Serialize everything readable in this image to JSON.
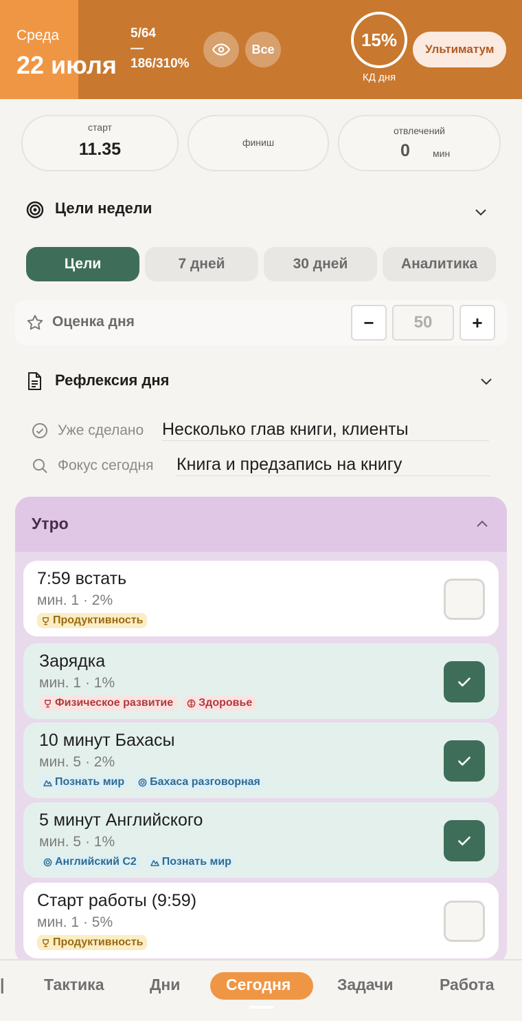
{
  "header": {
    "weekday": "Среда",
    "date": "22 июля",
    "stat_top": "5/64",
    "stat_dash": "—",
    "stat_bottom": "186/310%",
    "all_label": "Все",
    "kd_percent": "15%",
    "kd_label": "КД дня",
    "ultimatum_label": "Ультиматум",
    "colors": {
      "header_bg": "#c8782f",
      "date_bg": "#ef9645"
    }
  },
  "timing": {
    "start_label": "старт",
    "start_value": "11.35",
    "finish_label": "финиш",
    "distractions_label": "отвлечений",
    "distractions_value": "0",
    "distractions_unit": "мин"
  },
  "week_goals": {
    "title": "Цели недели",
    "icon": "target-icon"
  },
  "tabs": [
    {
      "label": "Цели",
      "active": true
    },
    {
      "label": "7 дней",
      "active": false
    },
    {
      "label": "30 дней",
      "active": false
    },
    {
      "label": "Аналитика",
      "active": false
    }
  ],
  "rating": {
    "label": "Оценка дня",
    "minus": "−",
    "value": "50",
    "plus": "+"
  },
  "reflection": {
    "title": "Рефлексия дня",
    "done_label": "Уже сделано",
    "done_value": "Несколько глав книги, клиенты",
    "focus_label": "Фокус сегодня",
    "focus_value": "Книга и предзапись на книгу"
  },
  "morning": {
    "title": "Утро",
    "tasks": [
      {
        "title": "7:59 встать",
        "meta": "мин. 1 · 2%",
        "done": false,
        "tags": [
          {
            "label": "Продуктивность",
            "icon": "trophy-icon"
          }
        ]
      },
      {
        "title": "Зарядка",
        "meta": "мин. 1 · 1%",
        "done": true,
        "tags": [
          {
            "label": "Физическое развитие",
            "icon": "trophy-icon"
          },
          {
            "label": "Здоровье",
            "icon": "brain-icon"
          }
        ]
      },
      {
        "title": "10 минут Бахасы",
        "meta": "мин. 5 · 2%",
        "done": true,
        "tags": [
          {
            "label": "Познать мир",
            "icon": "mountain-icon"
          },
          {
            "label": "Бахаса разговорная",
            "icon": "target-icon"
          }
        ]
      },
      {
        "title": "5 минут Английского",
        "meta": "мин. 5 · 1%",
        "done": true,
        "tags": [
          {
            "label": "Английский C2",
            "icon": "target-icon"
          },
          {
            "label": "Познать мир",
            "icon": "mountain-icon"
          }
        ]
      },
      {
        "title": "Старт работы (9:59)",
        "meta": "мин. 1 · 5%",
        "done": false,
        "tags": [
          {
            "label": "Продуктивность",
            "icon": "trophy-icon"
          }
        ]
      }
    ]
  },
  "nav": {
    "items": [
      "Тактика",
      "Дни",
      "Сегодня",
      "Задачи",
      "Работа"
    ],
    "active": "Сегодня",
    "accent": "#ef9645"
  }
}
